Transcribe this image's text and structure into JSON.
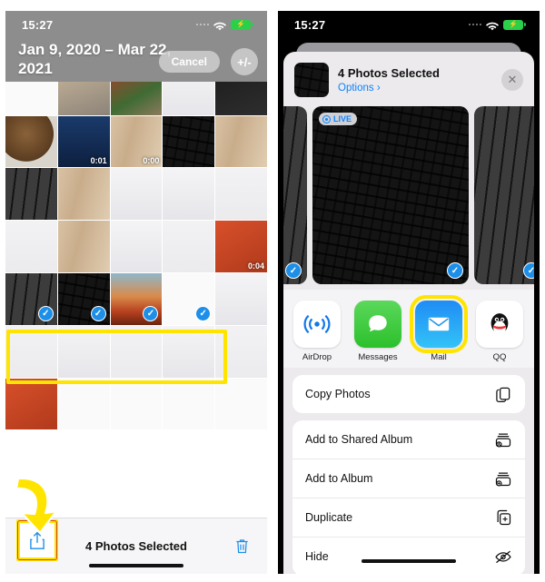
{
  "left_phone": {
    "status_bar": {
      "time": "15:27",
      "wifi_icon": "wifi-icon",
      "battery_icon": "battery-charging-icon"
    },
    "date_range_title": "Jan 9, 2020 – Mar 22, 2021",
    "cancel_label": "Cancel",
    "filter_label": "+/-",
    "video_durations": [
      "0:01",
      "0:00",
      "0:04"
    ],
    "selected_row": {
      "count": 4,
      "highlight_color": "#ffe400",
      "check_color": "#1d8fe8",
      "check_glyph": "✓"
    },
    "bottom_bar": {
      "share_icon": "share-icon",
      "status_label": "4 Photos Selected",
      "trash_icon": "trash-icon",
      "accent_color": "#1d8fe8"
    }
  },
  "right_phone": {
    "status_bar": {
      "time": "15:27",
      "wifi_icon": "wifi-icon",
      "battery_icon": "battery-charging-icon"
    },
    "share_sheet": {
      "title": "4 Photos Selected",
      "options_label": "Options",
      "options_chevron": "›",
      "close_icon": "close-icon",
      "close_glyph": "✕",
      "live_badge_label": "LIVE",
      "apps": [
        {
          "name": "AirDrop",
          "label": "AirDrop",
          "icon": "airdrop-icon",
          "highlighted": false
        },
        {
          "name": "Messages",
          "label": "Messages",
          "icon": "messages-icon",
          "highlighted": false
        },
        {
          "name": "Mail",
          "label": "Mail",
          "icon": "mail-icon",
          "highlighted": true
        },
        {
          "name": "QQ",
          "label": "QQ",
          "icon": "qq-icon",
          "highlighted": false
        }
      ],
      "action_groups": [
        [
          {
            "label": "Copy Photos",
            "icon": "copy-icon"
          }
        ],
        [
          {
            "label": "Add to Shared Album",
            "icon": "shared-album-icon"
          },
          {
            "label": "Add to Album",
            "icon": "add-album-icon"
          },
          {
            "label": "Duplicate",
            "icon": "duplicate-icon"
          },
          {
            "label": "Hide",
            "icon": "hide-icon"
          }
        ]
      ],
      "highlight_color": "#ffe400",
      "link_color": "#0a84ff"
    }
  }
}
